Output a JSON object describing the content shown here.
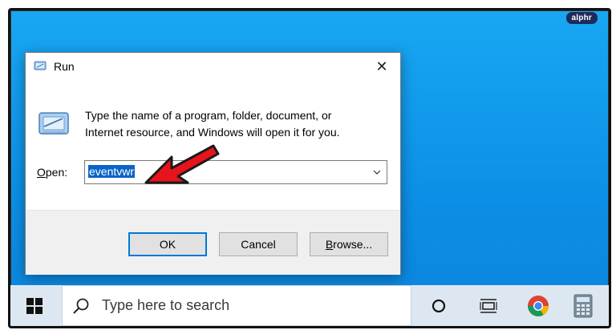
{
  "watermark": "alphr",
  "dialog": {
    "title": "Run",
    "close_glyph": "✕",
    "description_line1": "Type the name of a program, folder, document, or",
    "description_line2": "Internet resource, and Windows will open it for you.",
    "open_label_prefix": "O",
    "open_label_rest": "pen:",
    "input_value": "eventvwr",
    "buttons": {
      "ok": "OK",
      "cancel": "Cancel",
      "browse_prefix": "B",
      "browse_rest": "rowse..."
    }
  },
  "taskbar": {
    "search_placeholder": "Type here to search",
    "icons": [
      "windows-start-icon",
      "search-icon",
      "cortana-icon",
      "task-view-icon",
      "chrome-icon",
      "calculator-icon"
    ]
  },
  "colors": {
    "desktop": "#0c8fe6",
    "selection": "#0a64c8",
    "ok_border": "#0078d7",
    "arrow": "#e8141b"
  }
}
